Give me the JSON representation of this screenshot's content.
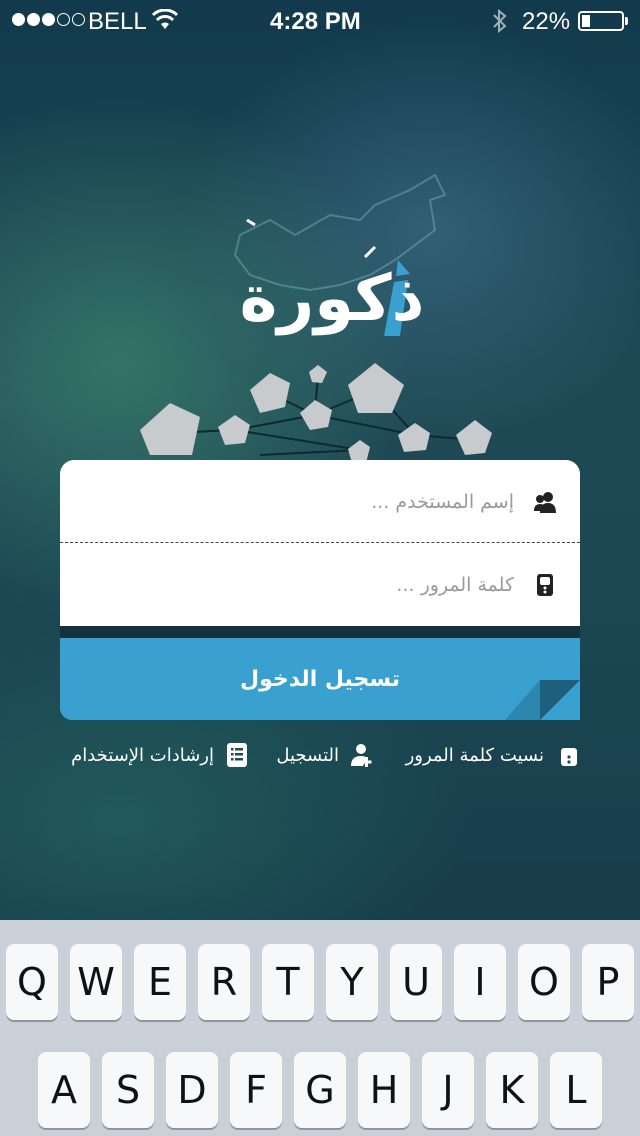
{
  "status_bar": {
    "carrier": "BELL",
    "time": "4:28 PM",
    "battery_percent": "22%",
    "battery_level": 0.22,
    "signal_bars": 3,
    "signal_total": 5
  },
  "app": {
    "logo_text": "ذكورة"
  },
  "login": {
    "username_placeholder": "إسم المستخدم ...",
    "password_placeholder": "كلمة المرور ...",
    "submit_label": "تسجيل الدخول"
  },
  "links": {
    "forgot_password": "نسيت كلمة المرور",
    "register": "التسجيل",
    "instructions": "إرشادات الإستخدام"
  },
  "keyboard": {
    "row1": [
      "Q",
      "W",
      "E",
      "R",
      "T",
      "Y",
      "U",
      "I",
      "O",
      "P"
    ],
    "row2": [
      "A",
      "S",
      "D",
      "F",
      "G",
      "H",
      "J",
      "K",
      "L"
    ]
  },
  "colors": {
    "accent": "#3aa0d0",
    "card": "#ffffff",
    "keyboard_bg": "#c9d0d7"
  }
}
